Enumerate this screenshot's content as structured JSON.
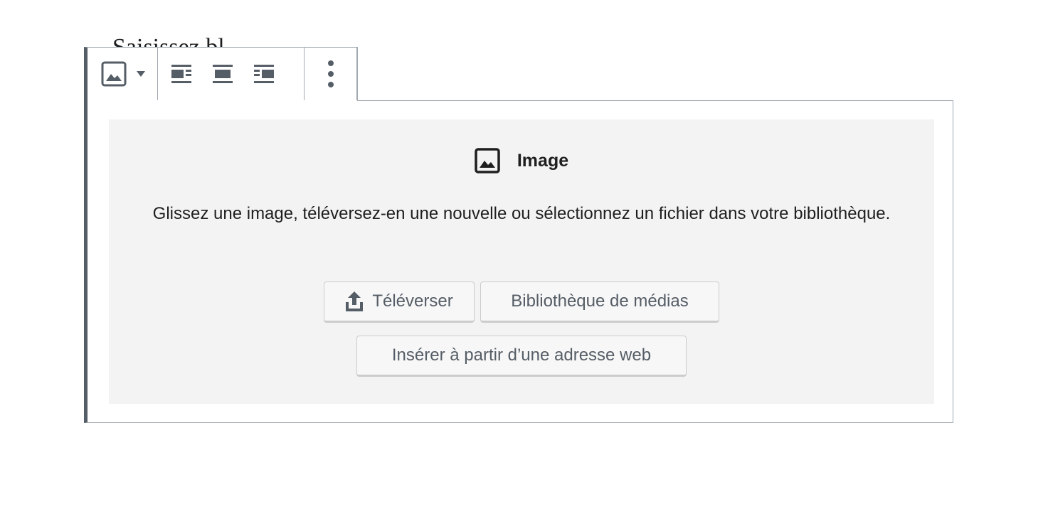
{
  "editor": {
    "partial_heading": "Saisissez bl"
  },
  "toolbar": {
    "block_type_icon": "image-icon",
    "align_left_icon": "align-left-icon",
    "align_center_icon": "align-center-icon",
    "align_right_icon": "align-right-icon",
    "more_options_icon": "more-vertical-icon"
  },
  "placeholder": {
    "title": "Image",
    "title_icon": "image-icon",
    "instructions": "Glissez une image, téléversez-en une nouvelle ou sélectionnez un fichier dans votre bibliothèque.",
    "upload_label": "Téléverser",
    "upload_icon": "upload-icon",
    "media_library_label": "Bibliothèque de médias",
    "insert_url_label": "Insérer à partir d’une adresse web"
  },
  "colors": {
    "accent_border": "#555d66",
    "block_border": "#a2aab2",
    "placeholder_bg": "#f3f3f3",
    "text": "#1e1e1e",
    "button_text": "#555d66"
  }
}
